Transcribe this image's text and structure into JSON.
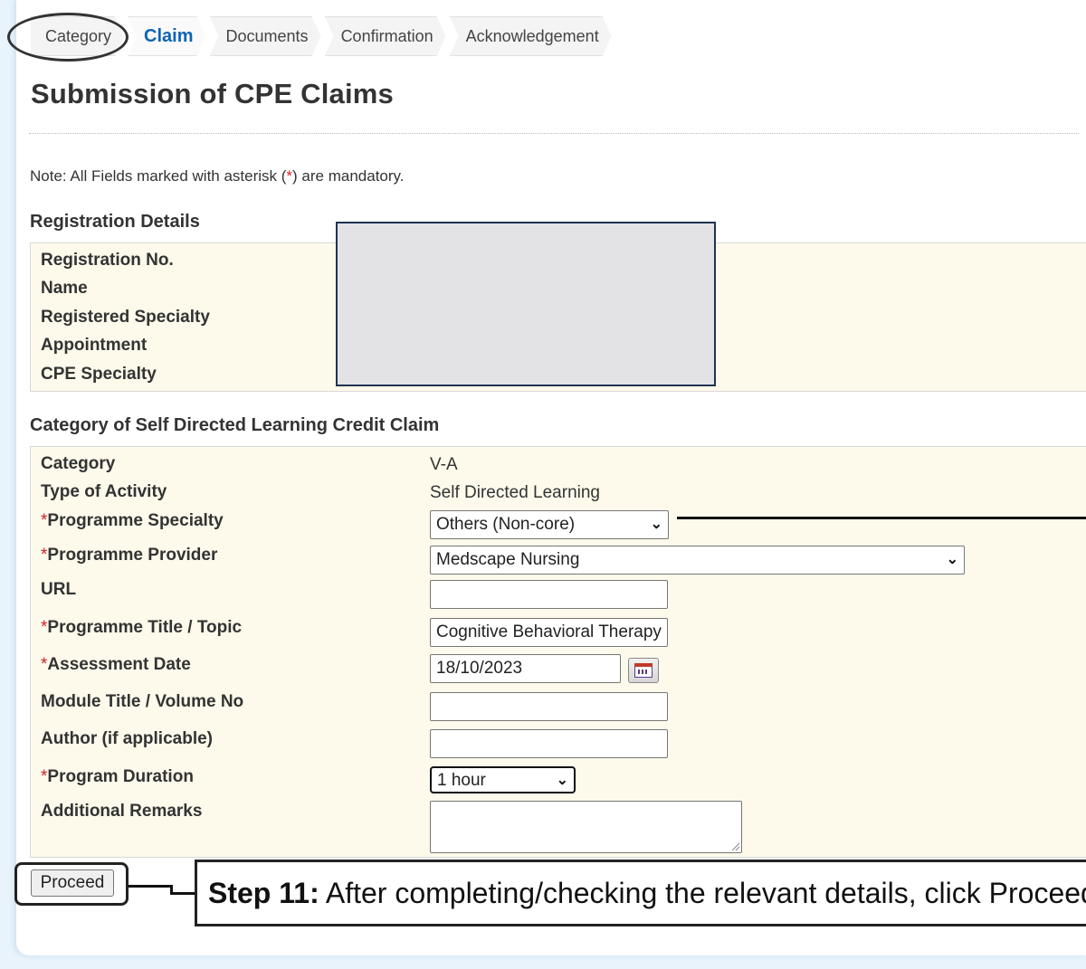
{
  "breadcrumb": {
    "steps": [
      "Category",
      "Claim",
      "Documents",
      "Confirmation",
      "Acknowledgement"
    ],
    "active": "Claim"
  },
  "page_title": "Submission of CPE Claims",
  "note": {
    "prefix": "Note: All Fields marked with asterisk (",
    "asterisk": "*",
    "suffix": ") are mandatory."
  },
  "registration": {
    "title": "Registration Details",
    "labels": [
      "Registration No.",
      "Name",
      "Registered Specialty",
      "Appointment",
      "CPE Specialty"
    ]
  },
  "category_section": {
    "title": "Category of Self Directed Learning Credit Claim",
    "category_label": "Category",
    "category_value": "V-A",
    "type_label": "Type of Activity",
    "type_value": "Self Directed Learning",
    "asterisk": "*",
    "specialty_label": "Programme Specialty",
    "specialty_value": "Others (Non-core)",
    "provider_label": "Programme Provider",
    "provider_value": "Medscape Nursing",
    "url_label": "URL",
    "url_value": "",
    "topic_label": "Programme Title / Topic",
    "topic_value": "Cognitive Behavioral Therapy",
    "date_label": "Assessment Date",
    "date_value": "18/10/2023",
    "module_label": "Module Title / Volume No",
    "module_value": "",
    "author_label": "Author (if applicable)",
    "author_value": "",
    "duration_label": "Program Duration",
    "duration_value": "1 hour",
    "remarks_label": "Additional Remarks",
    "remarks_value": ""
  },
  "proceed_label": "Proceed",
  "callout": {
    "step": "Step 11:",
    "text": " After completing/checking the relevant details, click Proceed"
  },
  "icons": {
    "select_arrow": "⌄",
    "calendar": "calendar-icon"
  }
}
